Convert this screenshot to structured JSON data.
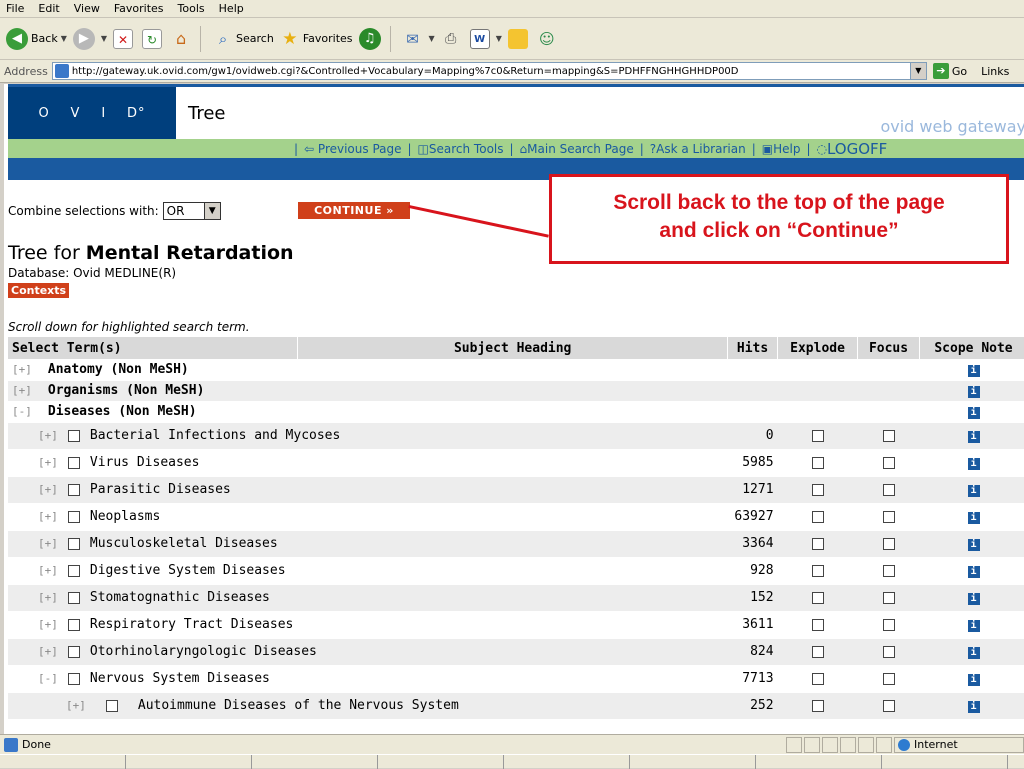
{
  "menu": [
    "File",
    "Edit",
    "View",
    "Favorites",
    "Tools",
    "Help"
  ],
  "toolbar": {
    "back": "Back",
    "search": "Search",
    "favorites": "Favorites"
  },
  "address": {
    "label": "Address",
    "url": "http://gateway.uk.ovid.com/gw1/ovidweb.cgi?&Controlled+Vocabulary=Mapping%7c0&Return=mapping&S=PDHFFNGHHGHHDP00D",
    "go": "Go",
    "links": "Links"
  },
  "header": {
    "logo_letters": [
      "O",
      "V",
      "I",
      "D°"
    ],
    "title": "Tree",
    "gateway": "ovid web gateway"
  },
  "nav": {
    "previous_page": "⇦ Previous Page",
    "search_tools": "Search Tools",
    "main_search_page": "Main Search Page",
    "ask_librarian": "Ask a Librarian",
    "help": "Help",
    "logoff": "LOGOFF"
  },
  "combine": {
    "label": "Combine selections with:",
    "value": "OR"
  },
  "continue_label": "CONTINUE »",
  "callout": {
    "line1": "Scroll back to the top of the page",
    "line2": "and click on “Continue”"
  },
  "tree": {
    "prefix": "Tree for ",
    "term": "Mental Retardation"
  },
  "database": "Database: Ovid MEDLINE(R)",
  "contexts_label": "Contexts",
  "scroll_note": "Scroll down for highlighted search term.",
  "table": {
    "headers": {
      "select": "Select Term(s)",
      "subject": "Subject Heading",
      "hits": "Hits",
      "explode": "Explode",
      "focus": "Focus",
      "scope": "Scope Note"
    },
    "rows": [
      {
        "expander": "[+]",
        "term": "Anatomy (Non MeSH)",
        "hits": "",
        "level": 0,
        "checkbox": false
      },
      {
        "expander": "[+]",
        "term": "Organisms (Non MeSH)",
        "hits": "",
        "level": 0,
        "checkbox": false
      },
      {
        "expander": "[-]",
        "term": "Diseases (Non MeSH)",
        "hits": "",
        "level": 0,
        "checkbox": false
      },
      {
        "expander": "[+]",
        "term": "Bacterial Infections and Mycoses",
        "hits": "0",
        "level": 1,
        "checkbox": true
      },
      {
        "expander": "[+]",
        "term": "Virus Diseases",
        "hits": "5985",
        "level": 1,
        "checkbox": true
      },
      {
        "expander": "[+]",
        "term": "Parasitic Diseases",
        "hits": "1271",
        "level": 1,
        "checkbox": true
      },
      {
        "expander": "[+]",
        "term": "Neoplasms",
        "hits": "63927",
        "level": 1,
        "checkbox": true
      },
      {
        "expander": "[+]",
        "term": "Musculoskeletal Diseases",
        "hits": "3364",
        "level": 1,
        "checkbox": true
      },
      {
        "expander": "[+]",
        "term": "Digestive System Diseases",
        "hits": "928",
        "level": 1,
        "checkbox": true
      },
      {
        "expander": "[+]",
        "term": "Stomatognathic Diseases",
        "hits": "152",
        "level": 1,
        "checkbox": true
      },
      {
        "expander": "[+]",
        "term": "Respiratory Tract Diseases",
        "hits": "3611",
        "level": 1,
        "checkbox": true
      },
      {
        "expander": "[+]",
        "term": "Otorhinolaryngologic Diseases",
        "hits": "824",
        "level": 1,
        "checkbox": true
      },
      {
        "expander": "[-]",
        "term": "Nervous System Diseases",
        "hits": "7713",
        "level": 1,
        "checkbox": true
      },
      {
        "expander": "[+]",
        "term": "Autoimmune Diseases of the Nervous System",
        "hits": "252",
        "level": 2,
        "checkbox": true
      }
    ]
  },
  "status": {
    "done": "Done",
    "zone": "Internet"
  }
}
